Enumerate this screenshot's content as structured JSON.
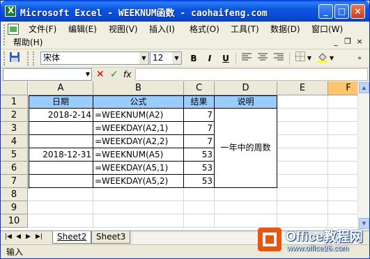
{
  "window": {
    "title": "Microsoft Excel - WEEKNUM函数 - caohaifeng.com",
    "minimize": "_",
    "maximize": "□",
    "close": "×"
  },
  "menu": {
    "items": [
      "文件(F)",
      "编辑(E)",
      "视图(V)",
      "插入(I)",
      "格式(O)",
      "工具(T)",
      "数据(D)",
      "窗口(W)",
      "帮助(H)"
    ],
    "mdi_min": "_",
    "mdi_restore": "❐",
    "mdi_close": "×"
  },
  "toolbar": {
    "font": "宋体",
    "size": "12",
    "bold": "B",
    "italic": "I",
    "underline": "U"
  },
  "formula_bar": {
    "name_box": "",
    "cancel": "✕",
    "enter": "✓",
    "fx": "fx",
    "content": ""
  },
  "columns": [
    "A",
    "B",
    "C",
    "D",
    "E",
    "F"
  ],
  "rows": [
    "1",
    "2",
    "3",
    "4",
    "5",
    "6",
    "7",
    "8",
    "9",
    "10"
  ],
  "table": {
    "headers": [
      "日期",
      "公式",
      "结果",
      "说明"
    ],
    "rows": [
      {
        "date": "2018-2-14",
        "formula": "=WEEKNUM(A2)",
        "result": "7"
      },
      {
        "date": "",
        "formula": "=WEEKDAY(A2,1)",
        "result": "7"
      },
      {
        "date": "",
        "formula": "=WEEKDAY(A2,2)",
        "result": "7"
      },
      {
        "date": "2018-12-31",
        "formula": "=WEEKNUM(A5)",
        "result": "53"
      },
      {
        "date": "",
        "formula": "=WEEKDAY(A5,1)",
        "result": "53"
      },
      {
        "date": "",
        "formula": "=WEEKDAY(A5,2)",
        "result": "53"
      }
    ],
    "note": "一年中的周数"
  },
  "sheets": [
    "Sheet2",
    "Sheet3"
  ],
  "status": "输入",
  "watermark": {
    "title": "Office教程网",
    "url": "www.office26.com"
  },
  "colors": {
    "header_fill": "#99ccff",
    "title_bar": "#0b56e0",
    "selected_col": "#ffc56b"
  }
}
